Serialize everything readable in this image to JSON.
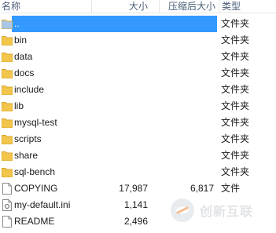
{
  "header": {
    "name": "名称",
    "size": "大小",
    "compressed": "压缩后大小",
    "type": "类型"
  },
  "rows": [
    {
      "name": "..",
      "size": "",
      "compressed": "",
      "type": "文件夹",
      "icon": "folder-up-icon",
      "selected": true
    },
    {
      "name": "bin",
      "size": "",
      "compressed": "",
      "type": "文件夹",
      "icon": "folder-icon"
    },
    {
      "name": "data",
      "size": "",
      "compressed": "",
      "type": "文件夹",
      "icon": "folder-icon"
    },
    {
      "name": "docs",
      "size": "",
      "compressed": "",
      "type": "文件夹",
      "icon": "folder-icon"
    },
    {
      "name": "include",
      "size": "",
      "compressed": "",
      "type": "文件夹",
      "icon": "folder-icon"
    },
    {
      "name": "lib",
      "size": "",
      "compressed": "",
      "type": "文件夹",
      "icon": "folder-icon"
    },
    {
      "name": "mysql-test",
      "size": "",
      "compressed": "",
      "type": "文件夹",
      "icon": "folder-icon"
    },
    {
      "name": "scripts",
      "size": "",
      "compressed": "",
      "type": "文件夹",
      "icon": "folder-icon"
    },
    {
      "name": "share",
      "size": "",
      "compressed": "",
      "type": "文件夹",
      "icon": "folder-icon"
    },
    {
      "name": "sql-bench",
      "size": "",
      "compressed": "",
      "type": "文件夹",
      "icon": "folder-icon"
    },
    {
      "name": "COPYING",
      "size": "17,987",
      "compressed": "6,817",
      "type": "文件",
      "icon": "file-icon"
    },
    {
      "name": "my-default.ini",
      "size": "1,141",
      "compressed": "",
      "type": "",
      "icon": "ini-file-icon"
    },
    {
      "name": "README",
      "size": "2,496",
      "compressed": "",
      "type": "",
      "icon": "file-icon"
    }
  ],
  "watermark": {
    "text": "创新互联"
  },
  "colors": {
    "selection": "#3399ff",
    "folder": "#f2c54b",
    "header_text": "#4c607a"
  }
}
